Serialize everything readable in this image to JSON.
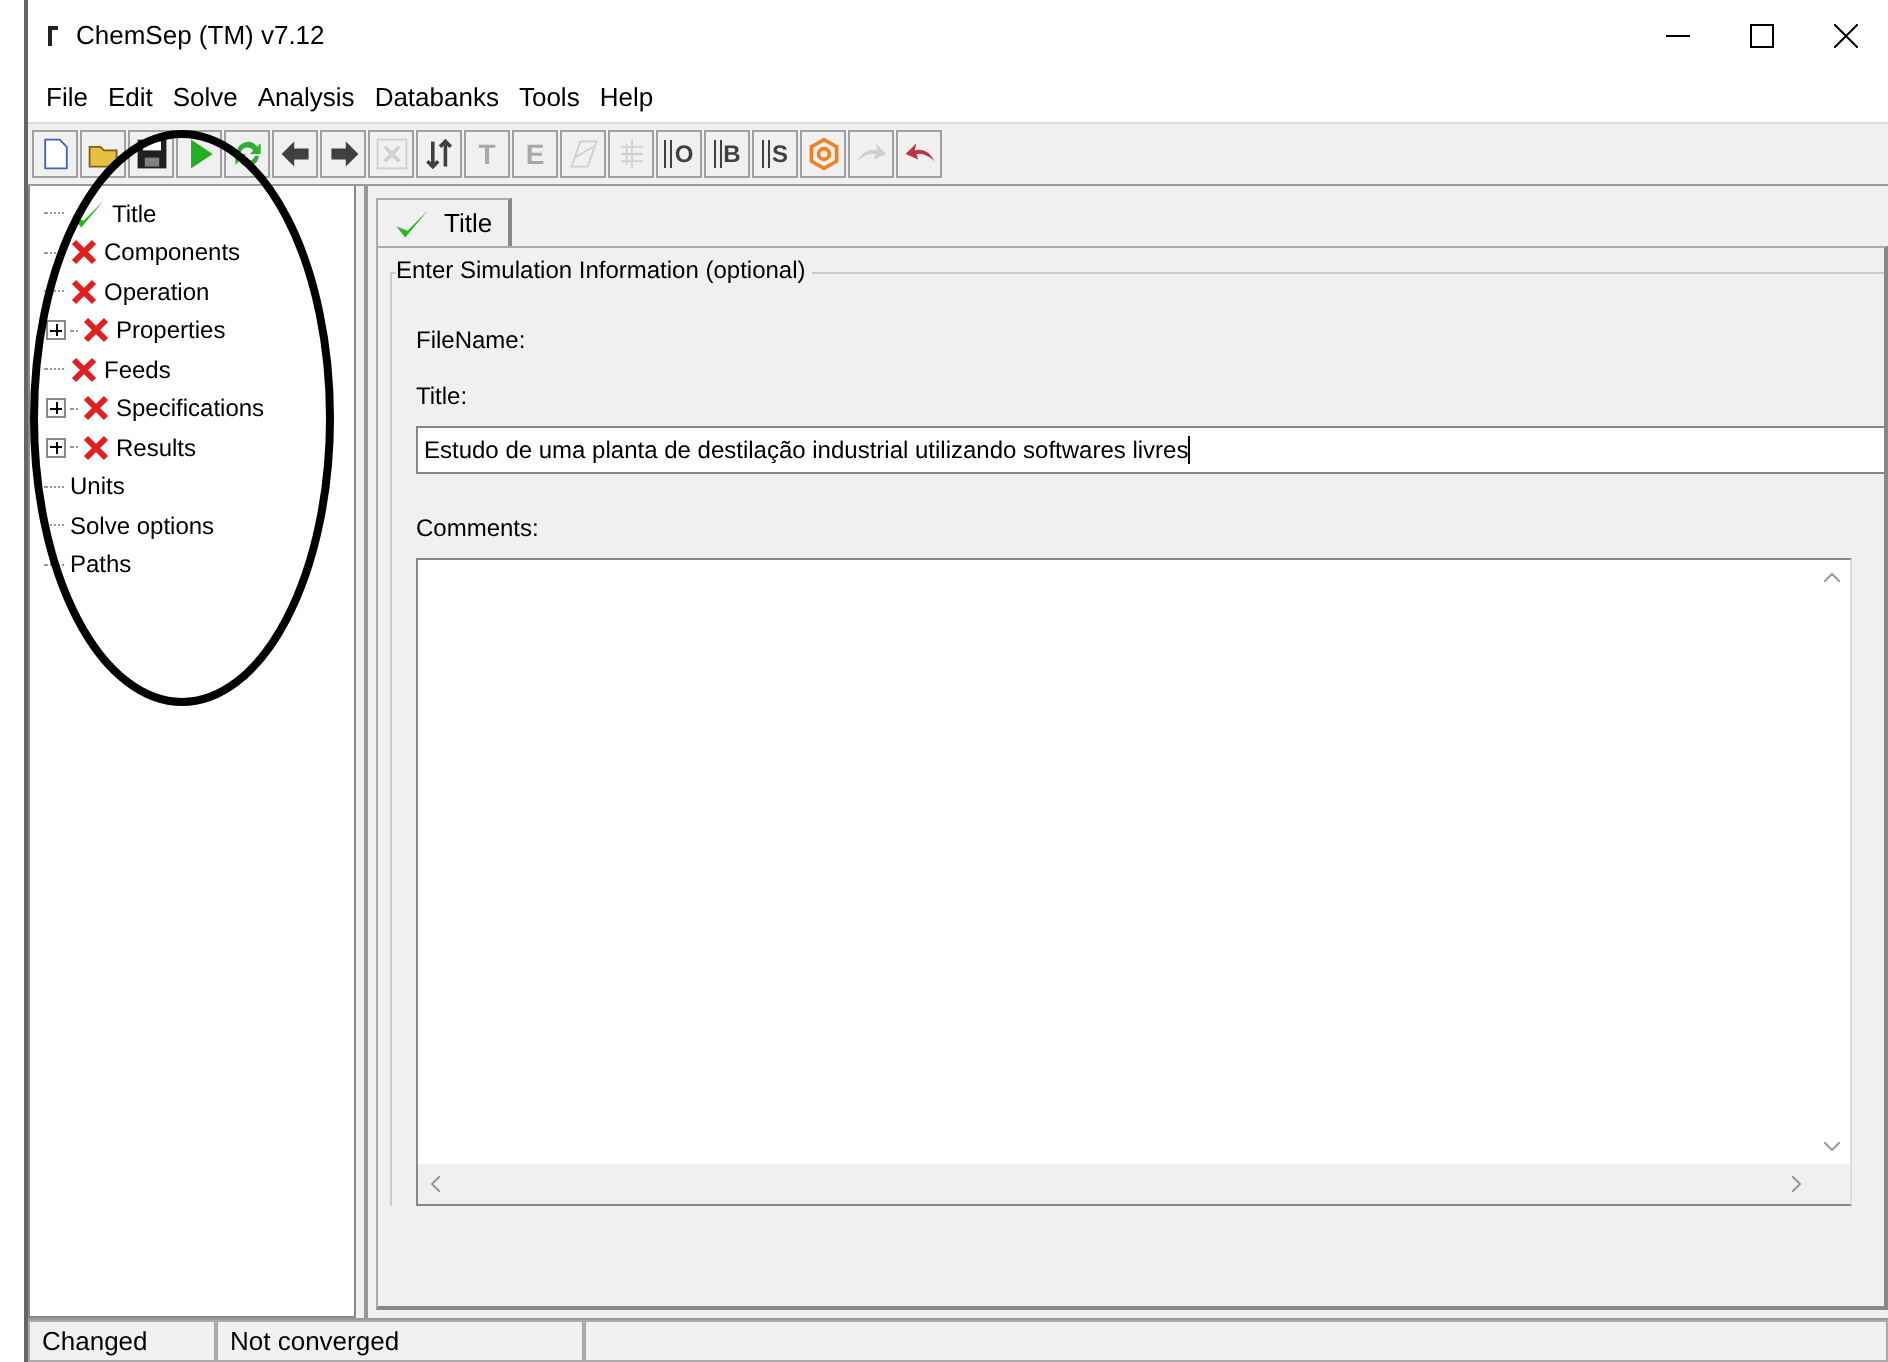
{
  "window": {
    "title": "ChemSep (TM) v7.12"
  },
  "menu": [
    {
      "label": "File"
    },
    {
      "label": "Edit"
    },
    {
      "label": "Solve"
    },
    {
      "label": "Analysis"
    },
    {
      "label": "Databanks"
    },
    {
      "label": "Tools"
    },
    {
      "label": "Help"
    }
  ],
  "toolbar": [
    {
      "kind": "new",
      "disabled": false
    },
    {
      "kind": "open",
      "disabled": false
    },
    {
      "kind": "save",
      "disabled": false
    },
    {
      "kind": "run",
      "disabled": false
    },
    {
      "kind": "refresh",
      "disabled": false
    },
    {
      "kind": "back",
      "disabled": false
    },
    {
      "kind": "forward",
      "disabled": false
    },
    {
      "kind": "delete",
      "disabled": true
    },
    {
      "kind": "sort",
      "disabled": false
    },
    {
      "kind": "letter",
      "glyph": "T",
      "disabled": true
    },
    {
      "kind": "letter",
      "glyph": "E",
      "disabled": true
    },
    {
      "kind": "diagram",
      "disabled": true
    },
    {
      "kind": "column",
      "disabled": true
    },
    {
      "kind": "list-letter",
      "glyph": "O",
      "disabled": false
    },
    {
      "kind": "list-letter",
      "glyph": "B",
      "disabled": false
    },
    {
      "kind": "list-letter",
      "glyph": "S",
      "disabled": false
    },
    {
      "kind": "hexagon",
      "disabled": false
    },
    {
      "kind": "redo",
      "disabled": true
    },
    {
      "kind": "undo",
      "disabled": false
    }
  ],
  "tree": [
    {
      "label": "Title",
      "kind": "done",
      "expandable": false
    },
    {
      "label": "Components",
      "kind": "error",
      "expandable": false
    },
    {
      "label": "Operation",
      "kind": "error",
      "expandable": false
    },
    {
      "label": "Properties",
      "kind": "error",
      "expandable": true
    },
    {
      "label": "Feeds",
      "kind": "error",
      "expandable": false
    },
    {
      "label": "Specifications",
      "kind": "error",
      "expandable": true
    },
    {
      "label": "Results",
      "kind": "error",
      "expandable": true
    },
    {
      "label": "Units",
      "kind": "plain",
      "expandable": false
    },
    {
      "label": "Solve options",
      "kind": "plain",
      "expandable": false
    },
    {
      "label": "Paths",
      "kind": "plain",
      "expandable": false
    }
  ],
  "tabs": [
    {
      "label": "Title",
      "kind": "done",
      "selected": true
    }
  ],
  "form": {
    "group_title": "Enter Simulation Information (optional)",
    "filename_label": "FileName:",
    "title_label": "Title:",
    "title_value": "Estudo de uma planta de destilação industrial utilizando softwares livres",
    "comments_label": "Comments:"
  },
  "status_bar": [
    {
      "text": "Changed"
    },
    {
      "text": "Not converged"
    }
  ]
}
